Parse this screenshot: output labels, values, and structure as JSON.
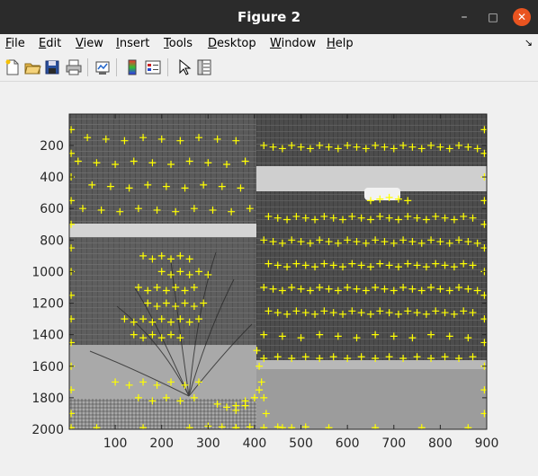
{
  "window": {
    "title": "Figure 2",
    "buttons": {
      "minimize": "–",
      "maximize": "□",
      "close": "✕"
    }
  },
  "menu": {
    "items": [
      {
        "label": "File",
        "accel": "F"
      },
      {
        "label": "Edit",
        "accel": "E"
      },
      {
        "label": "View",
        "accel": "V"
      },
      {
        "label": "Insert",
        "accel": "I"
      },
      {
        "label": "Tools",
        "accel": "T"
      },
      {
        "label": "Desktop",
        "accel": "D"
      },
      {
        "label": "Window",
        "accel": "W"
      },
      {
        "label": "Help",
        "accel": "H"
      }
    ],
    "dock_arrow": "↘"
  },
  "toolbar": {
    "icons": [
      "new-figure-icon",
      "open-file-icon",
      "save-icon",
      "print-icon",
      "link-plot-icon",
      "colorbar-icon",
      "legend-icon",
      "pointer-icon",
      "property-inspector-icon"
    ]
  },
  "chart_data": {
    "type": "scatter",
    "title": "",
    "xlabel": "",
    "ylabel": "",
    "xlim": [
      1,
      900
    ],
    "ylim": [
      1,
      2000
    ],
    "y_reversed": true,
    "xticks": [
      100,
      200,
      300,
      400,
      500,
      600,
      700,
      800,
      900
    ],
    "yticks": [
      200,
      400,
      600,
      800,
      1000,
      1200,
      1400,
      1600,
      1800,
      2000
    ],
    "marker": "+",
    "marker_color": "#ffff00",
    "background": "grayscale photograph of building wall with shingles and a shrub",
    "series": [
      {
        "values_note": "dense detected feature points across image",
        "x": [
          40,
          80,
          120,
          160,
          200,
          240,
          280,
          320,
          360,
          20,
          60,
          100,
          140,
          180,
          220,
          260,
          300,
          340,
          380,
          50,
          90,
          130,
          170,
          210,
          250,
          290,
          330,
          370,
          30,
          70,
          110,
          150,
          190,
          230,
          270,
          310,
          350,
          390,
          160,
          180,
          200,
          220,
          240,
          260,
          200,
          220,
          240,
          260,
          280,
          300,
          150,
          170,
          190,
          210,
          230,
          250,
          270,
          170,
          190,
          210,
          230,
          250,
          270,
          290,
          120,
          140,
          160,
          180,
          200,
          220,
          240,
          260,
          280,
          140,
          160,
          180,
          200,
          220,
          240,
          100,
          130,
          160,
          190,
          220,
          250,
          280,
          150,
          180,
          210,
          240,
          270,
          420,
          440,
          460,
          480,
          500,
          520,
          540,
          560,
          580,
          600,
          620,
          640,
          660,
          680,
          700,
          720,
          740,
          760,
          780,
          800,
          820,
          840,
          860,
          880,
          430,
          450,
          470,
          490,
          510,
          530,
          550,
          570,
          590,
          610,
          630,
          650,
          670,
          690,
          710,
          730,
          750,
          770,
          790,
          810,
          830,
          850,
          870,
          420,
          440,
          460,
          480,
          500,
          520,
          540,
          560,
          580,
          600,
          620,
          640,
          660,
          680,
          700,
          720,
          740,
          760,
          780,
          800,
          820,
          840,
          860,
          880,
          430,
          450,
          470,
          490,
          510,
          530,
          550,
          570,
          590,
          610,
          630,
          650,
          670,
          690,
          710,
          730,
          750,
          770,
          790,
          810,
          830,
          850,
          870,
          420,
          440,
          460,
          480,
          500,
          520,
          540,
          560,
          580,
          600,
          620,
          640,
          660,
          680,
          700,
          720,
          740,
          760,
          780,
          800,
          820,
          840,
          860,
          880,
          430,
          450,
          470,
          490,
          510,
          530,
          550,
          570,
          590,
          610,
          630,
          650,
          670,
          690,
          710,
          730,
          750,
          770,
          790,
          810,
          830,
          850,
          870,
          420,
          460,
          500,
          540,
          580,
          620,
          660,
          700,
          740,
          780,
          820,
          860,
          650,
          670,
          690,
          710,
          730,
          420,
          450,
          480,
          510,
          540,
          570,
          600,
          630,
          660,
          690,
          720,
          750,
          780,
          810,
          840,
          870,
          5,
          5,
          5,
          5,
          5,
          5,
          5,
          5,
          5,
          5,
          5,
          5,
          5,
          5,
          895,
          895,
          895,
          895,
          895,
          895,
          895,
          895,
          895,
          895,
          895,
          895,
          895,
          60,
          160,
          260,
          360,
          460,
          560,
          660,
          760,
          860,
          405,
          410,
          415,
          420,
          425,
          410,
          400,
          380,
          360,
          340,
          320,
          360,
          380,
          400,
          300,
          330,
          360,
          390,
          420,
          450,
          480,
          510
        ],
        "y": [
          150,
          160,
          170,
          150,
          160,
          170,
          150,
          160,
          170,
          300,
          310,
          320,
          300,
          310,
          320,
          300,
          310,
          320,
          300,
          450,
          460,
          470,
          450,
          460,
          470,
          450,
          460,
          470,
          600,
          610,
          620,
          600,
          610,
          620,
          600,
          610,
          620,
          600,
          900,
          920,
          900,
          920,
          900,
          920,
          1000,
          1020,
          1000,
          1020,
          1000,
          1020,
          1100,
          1120,
          1100,
          1120,
          1100,
          1120,
          1100,
          1200,
          1220,
          1200,
          1220,
          1200,
          1220,
          1200,
          1300,
          1320,
          1300,
          1320,
          1300,
          1320,
          1300,
          1320,
          1300,
          1400,
          1420,
          1400,
          1420,
          1400,
          1420,
          1700,
          1720,
          1700,
          1720,
          1700,
          1720,
          1700,
          1800,
          1820,
          1800,
          1820,
          1800,
          200,
          210,
          220,
          200,
          210,
          220,
          200,
          210,
          220,
          200,
          210,
          220,
          200,
          210,
          220,
          200,
          210,
          220,
          200,
          210,
          220,
          200,
          210,
          220,
          650,
          660,
          670,
          650,
          660,
          670,
          650,
          660,
          670,
          650,
          660,
          670,
          650,
          660,
          670,
          650,
          660,
          670,
          650,
          660,
          670,
          650,
          660,
          800,
          810,
          820,
          800,
          810,
          820,
          800,
          810,
          820,
          800,
          810,
          820,
          800,
          810,
          820,
          800,
          810,
          820,
          800,
          810,
          820,
          800,
          810,
          820,
          950,
          960,
          970,
          950,
          960,
          970,
          950,
          960,
          970,
          950,
          960,
          970,
          950,
          960,
          970,
          950,
          960,
          970,
          950,
          960,
          970,
          950,
          960,
          1100,
          1110,
          1120,
          1100,
          1110,
          1120,
          1100,
          1110,
          1120,
          1100,
          1110,
          1120,
          1100,
          1110,
          1120,
          1100,
          1110,
          1120,
          1100,
          1110,
          1120,
          1100,
          1110,
          1120,
          1250,
          1260,
          1270,
          1250,
          1260,
          1270,
          1250,
          1260,
          1270,
          1250,
          1260,
          1270,
          1250,
          1260,
          1270,
          1250,
          1260,
          1270,
          1250,
          1260,
          1270,
          1250,
          1260,
          1400,
          1410,
          1420,
          1400,
          1410,
          1420,
          1400,
          1410,
          1420,
          1400,
          1410,
          1420,
          550,
          540,
          530,
          540,
          550,
          1550,
          1540,
          1550,
          1540,
          1550,
          1540,
          1550,
          1540,
          1550,
          1540,
          1550,
          1540,
          1550,
          1540,
          1550,
          1540,
          100,
          250,
          400,
          550,
          700,
          850,
          1000,
          1150,
          1300,
          1450,
          1600,
          1750,
          1900,
          1990,
          100,
          250,
          400,
          550,
          700,
          850,
          1000,
          1150,
          1300,
          1450,
          1600,
          1750,
          1900,
          1990,
          1990,
          1990,
          1990,
          1990,
          1990,
          1990,
          1990,
          1990,
          1500,
          1600,
          1700,
          1800,
          1900,
          1750,
          1800,
          1850,
          1880,
          1860,
          1840,
          1850,
          1820,
          1800,
          1980,
          1985,
          1990,
          1985,
          1990,
          1985,
          1990,
          1985
        ]
      }
    ]
  }
}
